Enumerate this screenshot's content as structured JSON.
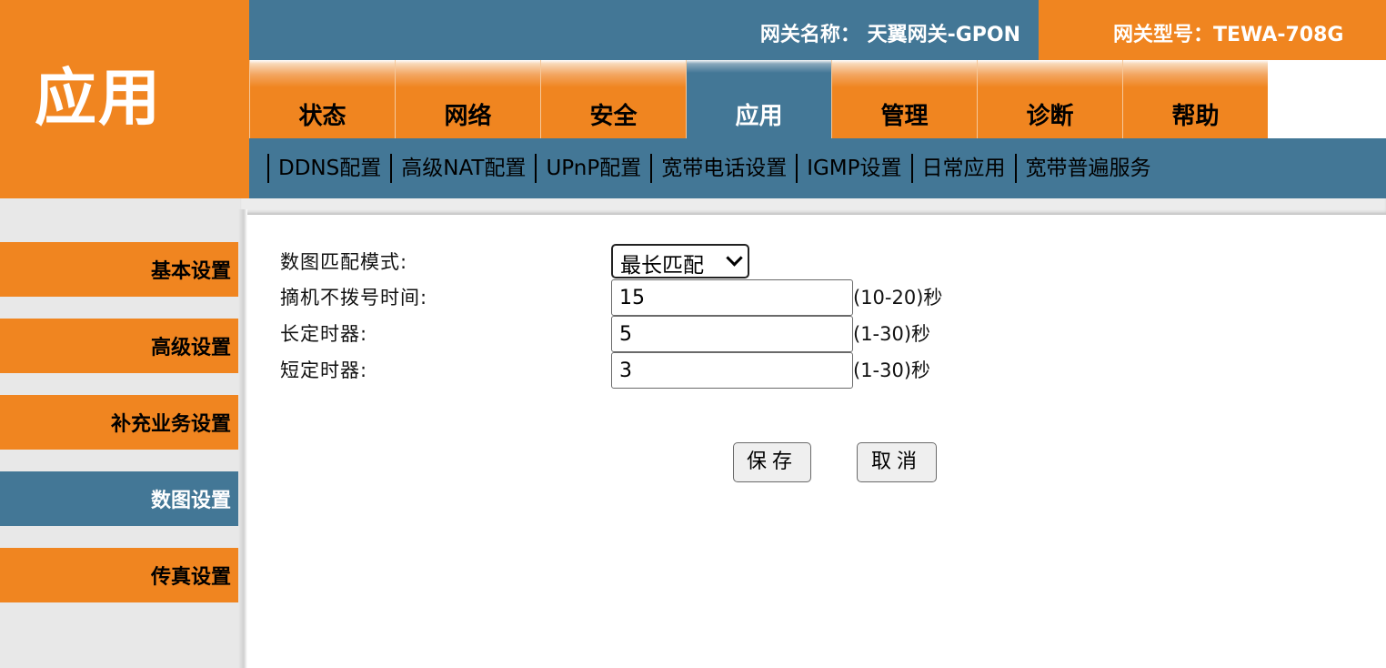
{
  "brand": {
    "title": "应用"
  },
  "header": {
    "gateway_name": "网关名称：  天翼网关-GPON",
    "gateway_model": "网关型号：TEWA-708G"
  },
  "tabs": [
    {
      "label": "状态",
      "active": false
    },
    {
      "label": "网络",
      "active": false
    },
    {
      "label": "安全",
      "active": false
    },
    {
      "label": "应用",
      "active": true
    },
    {
      "label": "管理",
      "active": false
    },
    {
      "label": "诊断",
      "active": false
    },
    {
      "label": "帮助",
      "active": false
    }
  ],
  "subnav": [
    "DDNS配置",
    "高级NAT配置",
    "UPnP配置",
    "宽带电话设置",
    "IGMP设置",
    "日常应用",
    "宽带普遍服务"
  ],
  "sidebar": [
    {
      "label": "基本设置",
      "active": false
    },
    {
      "label": "高级设置",
      "active": false
    },
    {
      "label": "补充业务设置",
      "active": false
    },
    {
      "label": "数图设置",
      "active": true
    },
    {
      "label": "传真设置",
      "active": false
    }
  ],
  "form": {
    "mode_label": "数图匹配模式:",
    "mode_value": "最长匹配",
    "offhook_label": "摘机不拨号时间:",
    "offhook_value": "15",
    "offhook_hint": "(10-20)秒",
    "long_timer_label": "长定时器:",
    "long_timer_value": "5",
    "long_timer_hint": "(1-30)秒",
    "short_timer_label": "短定时器:",
    "short_timer_value": "3",
    "short_timer_hint": "(1-30)秒",
    "save_label": "保存",
    "cancel_label": "取消"
  },
  "colors": {
    "orange": "#f08520",
    "blue": "#437796"
  }
}
